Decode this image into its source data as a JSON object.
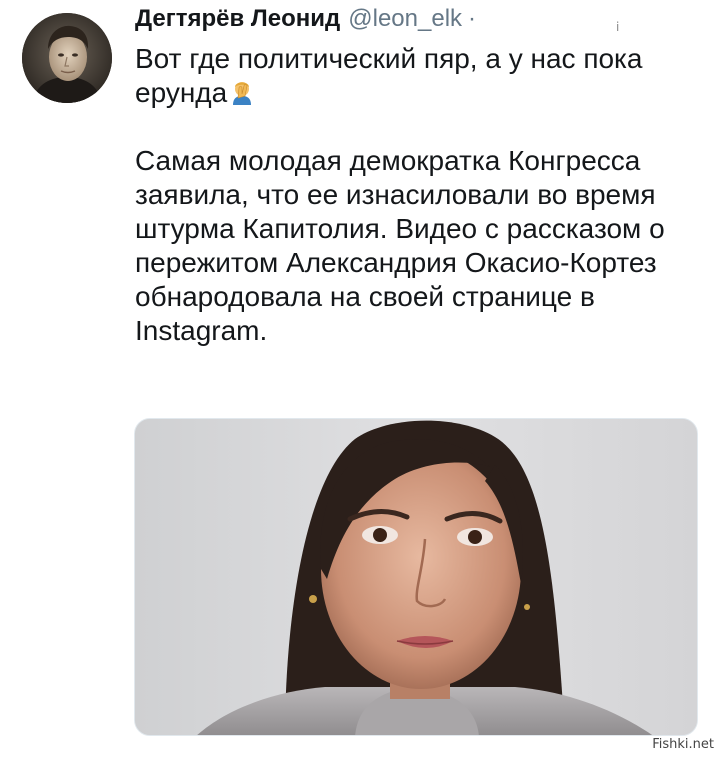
{
  "tweet": {
    "display_name": "Дегтярёв Леонид",
    "handle": "@leon_elk",
    "separator": "·",
    "text_line1": "Вот где политический пяр, а у нас пока ерунда",
    "emoji_icon": "facepalm-icon",
    "text_paragraph2": "Самая молодая демократка Конгресса заявила, что ее изнасиловали во время штурма Капитолия. Видео с рассказом о пережитом Александрия Окасио-Кортез обнародовала на своей странице в Instagram."
  },
  "media": {
    "kind": "photo"
  },
  "watermark": {
    "text": "Fishki.net"
  },
  "colors": {
    "text": "#14171a",
    "secondary": "#657786",
    "media_background": "#d6d6d8"
  }
}
